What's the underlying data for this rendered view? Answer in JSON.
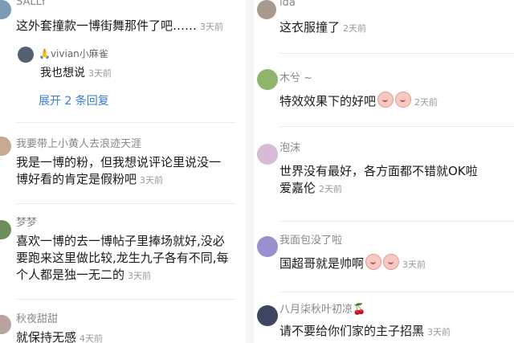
{
  "left_column": {
    "comments": [
      {
        "username": "SALLY",
        "text": "这外套撞款一博街舞那件了吧……",
        "time": "3天前",
        "reply": {
          "username": "🙏vivian小麻雀",
          "text": "我也想说",
          "time": "3天前"
        },
        "expand_label": "展开 2 条回复"
      },
      {
        "username": "我要带上小黄人去浪迹天涯",
        "text_line1": "我是一博的粉，但我想说评论里说没一",
        "text_line2": "博好看的肯定是假粉吧",
        "time": "3天前"
      },
      {
        "username": "梦梦",
        "text_line1": "喜欢一博的去一博帖子里捧场就好,没必",
        "text_line2": "要跑来这里做比较,龙生九子各有不同,每",
        "text_line3": "个人都是独一无二的",
        "time": "3天前"
      },
      {
        "username": "秋夜甜甜",
        "text": "就保持无感",
        "time": "4天前"
      }
    ]
  },
  "right_column": {
    "comments": [
      {
        "username": "ida",
        "text": "这衣服撞了",
        "time": "2天前"
      },
      {
        "username": "木兮 ~",
        "text": "特效效果下的好吧",
        "emoji": [
          "crying-face-emoji",
          "crying-face-emoji"
        ],
        "time": "2天前"
      },
      {
        "username": "泡沫",
        "text_line1": "世界没有最好，各方面都不错就OK啦",
        "text_line2": "爱嘉伦",
        "time": "2天前"
      },
      {
        "username": "我面包没了啦",
        "text": "国超哥就是帅啊",
        "emoji": [
          "crying-face-emoji",
          "crying-face-emoji"
        ],
        "time": "3天前"
      },
      {
        "username": "八月柒秋叶初凉",
        "username_suffix": "🍒",
        "text": "请不要给你们家的主子招黑",
        "time": "3天前"
      }
    ]
  },
  "watermark": "家的主子招黑",
  "colors": {
    "link": "#3a7bd5",
    "meta": "#999999",
    "username": "#888888"
  }
}
